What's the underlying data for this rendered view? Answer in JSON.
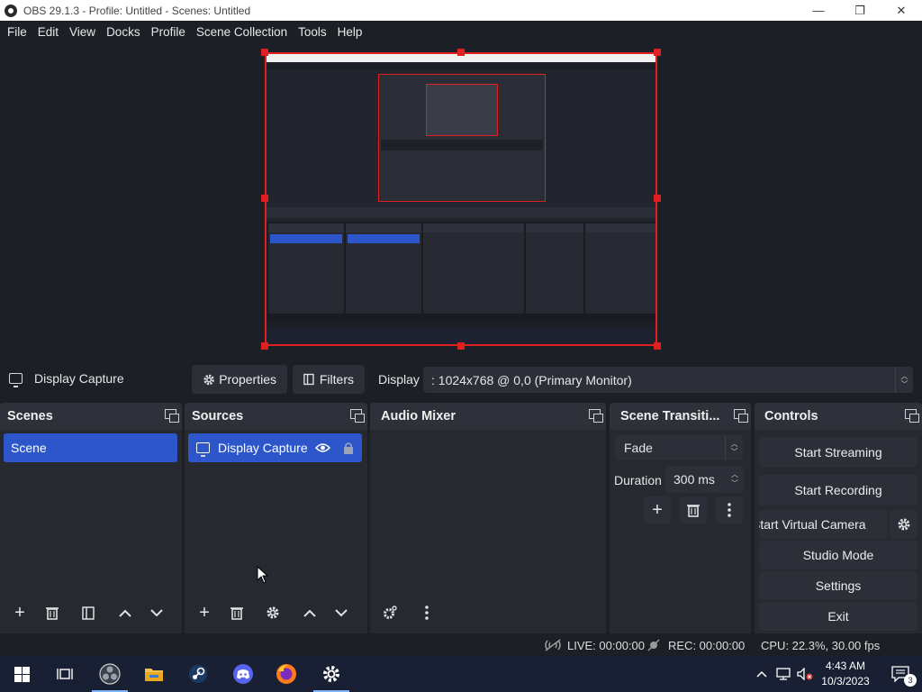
{
  "window": {
    "title": "OBS 29.1.3 - Profile: Untitled - Scenes: Untitled",
    "minimize": "—",
    "maximize": "❐",
    "close": "✕"
  },
  "menu": [
    "File",
    "Edit",
    "View",
    "Docks",
    "Profile",
    "Scene Collection",
    "Tools",
    "Help"
  ],
  "source_toolbar": {
    "selected_source": "Display Capture",
    "properties_label": "Properties",
    "filters_label": "Filters",
    "display_label": "Display",
    "display_value": ": 1024x768 @ 0,0 (Primary Monitor)"
  },
  "scenes": {
    "title": "Scenes",
    "items": [
      "Scene"
    ]
  },
  "sources": {
    "title": "Sources",
    "items": [
      "Display Capture"
    ]
  },
  "audio_mixer": {
    "title": "Audio Mixer"
  },
  "transitions": {
    "title": "Scene Transiti...",
    "transition": "Fade",
    "duration_label": "Duration",
    "duration_value": "300 ms"
  },
  "controls": {
    "title": "Controls",
    "start_streaming": "Start Streaming",
    "start_recording": "Start Recording",
    "start_virtual_camera": "Start Virtual Camera",
    "studio_mode": "Studio Mode",
    "settings": "Settings",
    "exit": "Exit"
  },
  "status": {
    "live": "LIVE: 00:00:00",
    "rec": "REC: 00:00:00",
    "cpu": "CPU: 22.3%, 30.00 fps"
  },
  "taskbar": {
    "time": "4:43 AM",
    "date": "10/3/2023",
    "notifications": "3"
  },
  "colors": {
    "accent": "#2c56c9",
    "background": "#1d1f26",
    "dock": "#262930",
    "selection_border": "#e02020"
  }
}
